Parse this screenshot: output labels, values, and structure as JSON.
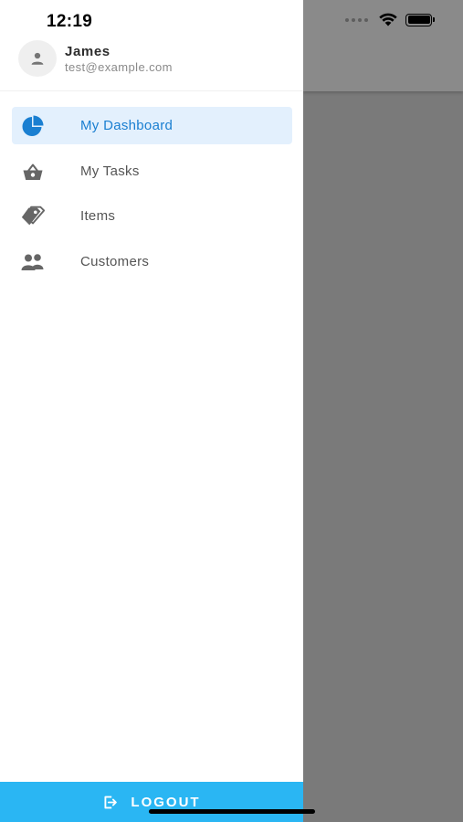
{
  "status_bar": {
    "time": "12:19"
  },
  "user": {
    "name": "James",
    "email": "test@example.com"
  },
  "menu": {
    "items": [
      {
        "label": "My Dashboard",
        "icon": "pie-chart-icon",
        "active": true
      },
      {
        "label": "My Tasks",
        "icon": "basket-icon",
        "active": false
      },
      {
        "label": "Items",
        "icon": "tags-icon",
        "active": false
      },
      {
        "label": "Customers",
        "icon": "users-icon",
        "active": false
      }
    ]
  },
  "logout": {
    "label": "LOGOUT",
    "icon": "logout-icon"
  },
  "colors": {
    "accent": "#1a7fd1",
    "active_bg": "#e3f0fd",
    "logout_bg": "#2ab6f3",
    "backdrop": "#7a7a7a"
  }
}
